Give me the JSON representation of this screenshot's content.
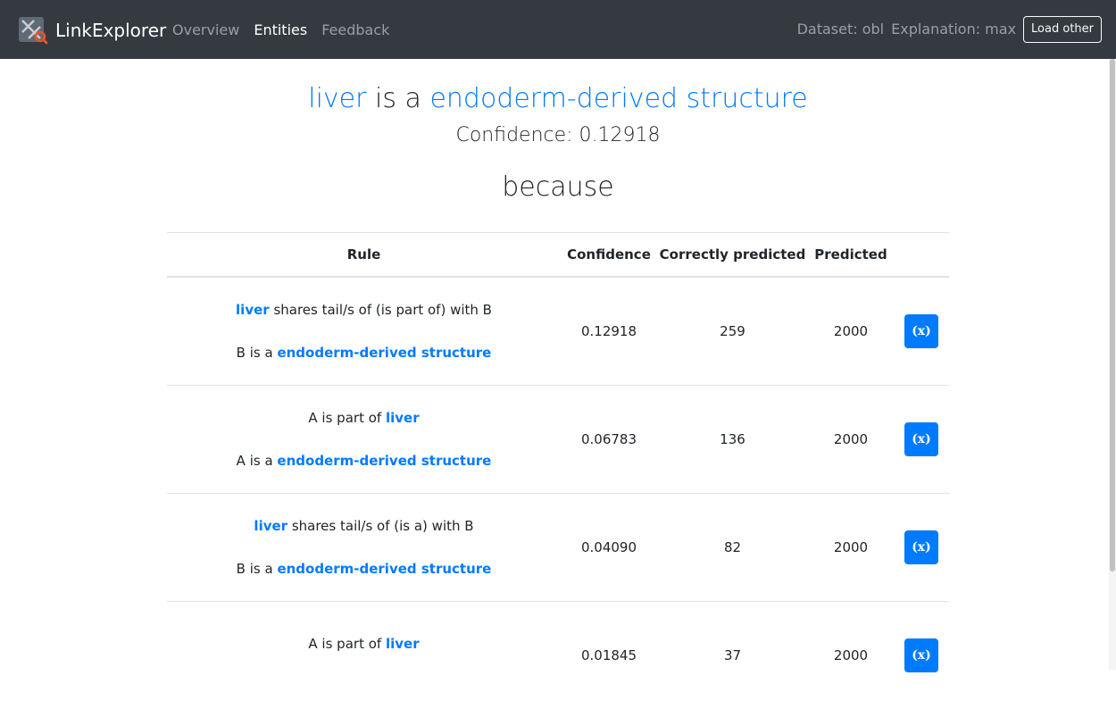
{
  "navbar": {
    "brand": "LinkExplorer",
    "links": [
      {
        "label": "Overview",
        "active": false
      },
      {
        "label": "Entities",
        "active": true
      },
      {
        "label": "Feedback",
        "active": false
      }
    ],
    "dataset": "Dataset: obl",
    "explanation": "Explanation: max",
    "load_button": "Load other"
  },
  "headline": {
    "subject": "liver",
    "relation": "is a",
    "object": "endoderm-derived structure",
    "confidence": "Confidence: 0.12918",
    "because": "because"
  },
  "table": {
    "headers": [
      "Rule",
      "Confidence",
      "Correctly predicted",
      "Predicted",
      ""
    ],
    "rows": [
      {
        "line1": {
          "pre": "",
          "link": "liver",
          "post": " shares tail/s of (is part of) with B"
        },
        "line2": {
          "pre": "B is a ",
          "link": "endoderm-derived structure",
          "post": ""
        },
        "confidence": "0.12918",
        "correct": "259",
        "predicted": "2000",
        "button": "(x)"
      },
      {
        "line1": {
          "pre": "A is part of ",
          "link": "liver",
          "post": ""
        },
        "line2": {
          "pre": "A is a ",
          "link": "endoderm-derived structure",
          "post": ""
        },
        "confidence": "0.06783",
        "correct": "136",
        "predicted": "2000",
        "button": "(x)"
      },
      {
        "line1": {
          "pre": "",
          "link": "liver",
          "post": " shares tail/s of (is a) with B"
        },
        "line2": {
          "pre": "B is a ",
          "link": "endoderm-derived structure",
          "post": ""
        },
        "confidence": "0.04090",
        "correct": "82",
        "predicted": "2000",
        "button": "(x)"
      },
      {
        "line1": {
          "pre": "A is part of ",
          "link": "liver",
          "post": ""
        },
        "line2": {
          "pre": "",
          "link": "",
          "post": ""
        },
        "confidence": "0.01845",
        "correct": "37",
        "predicted": "2000",
        "button": "(x)"
      }
    ]
  },
  "colors": {
    "navbar_bg": "#343a40",
    "link": "#007bff",
    "button_primary": "#007bff"
  }
}
